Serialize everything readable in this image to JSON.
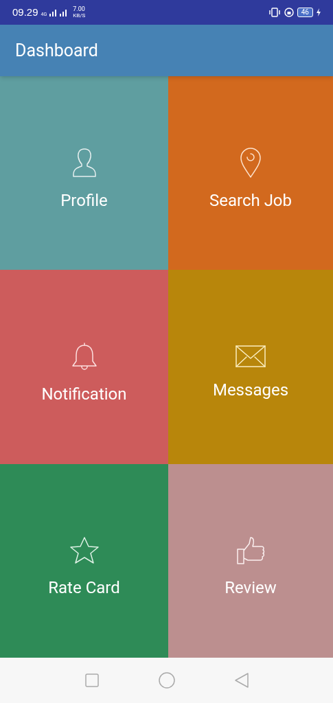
{
  "status_bar": {
    "time": "09.29",
    "network": "4G",
    "speed": "7.00",
    "speed_unit": "KB/S",
    "battery": "46"
  },
  "app_bar": {
    "title": "Dashboard"
  },
  "tiles": [
    {
      "label": "Profile",
      "kind": "person",
      "color": "#5f9ea0"
    },
    {
      "label": "Search Job",
      "kind": "pin",
      "color": "#d2691e"
    },
    {
      "label": "Notification",
      "kind": "bell",
      "color": "#cd5c5c"
    },
    {
      "label": "Messages",
      "kind": "mail",
      "color": "#b8860b"
    },
    {
      "label": "Rate Card",
      "kind": "star",
      "color": "#2e8b57"
    },
    {
      "label": "Review",
      "kind": "thumb",
      "color": "#bc8f8f"
    }
  ]
}
